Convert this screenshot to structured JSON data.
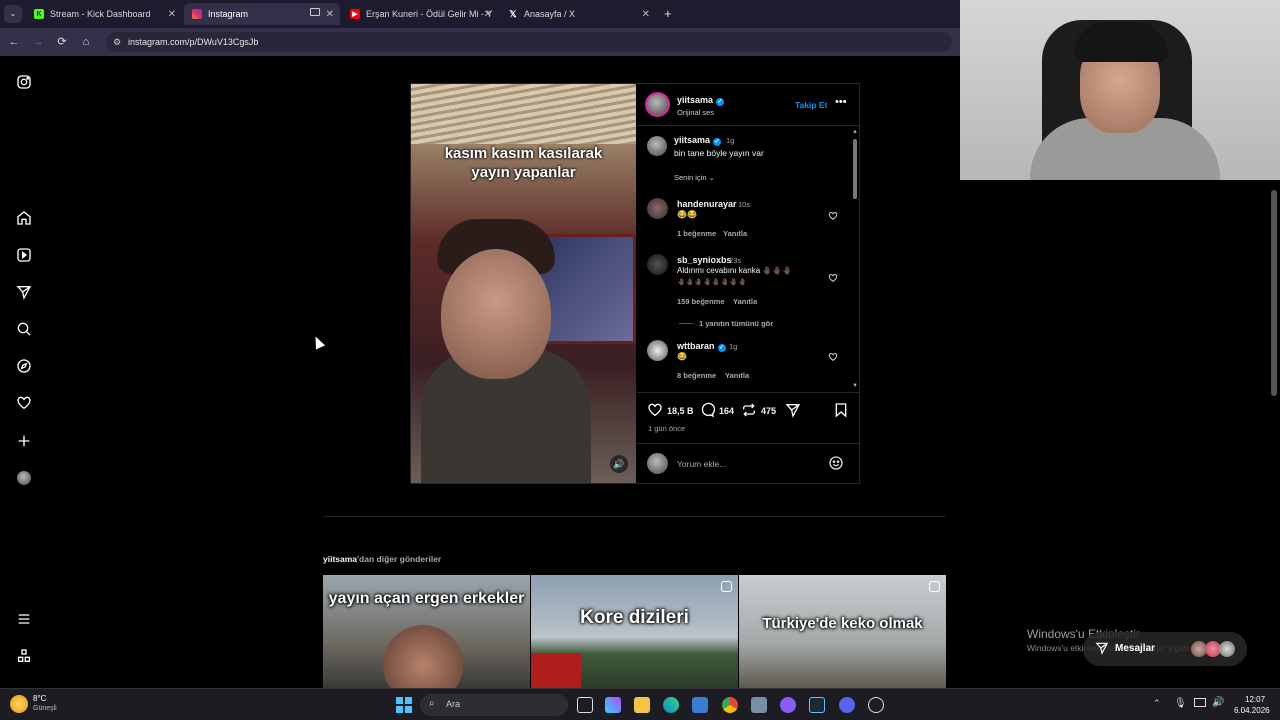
{
  "browser": {
    "tabs": [
      {
        "label": "Stream - Kick Dashboard",
        "active": false
      },
      {
        "label": "Instagram",
        "active": true
      },
      {
        "label": "Erşan Kuneri - Ödül Gelir Mi - Y",
        "active": false
      },
      {
        "label": "Anasayfa / X",
        "active": false
      }
    ],
    "new_tab": "+",
    "url": "instagram.com/p/DWuV13CgsJb"
  },
  "sidebar": {
    "icons": [
      "instagram-logo-icon",
      "home-icon",
      "reels-icon",
      "send-icon",
      "search-icon",
      "explore-icon",
      "heart-icon",
      "create-icon",
      "profile-avatar",
      "menu-icon",
      "more-apps-icon"
    ]
  },
  "post": {
    "video_caption": "kasım kasım kasılarak yayın yapanlar",
    "author": "yiitsama",
    "audio": "Orijinal ses",
    "follow_label": "Takip Et",
    "caption_author": "yiitsama",
    "caption_time": "1g",
    "caption_text": "bin tane böyle yayın var",
    "sort_label": "Senin için",
    "comments": [
      {
        "user": "handenurayar",
        "time": "10s",
        "text": "😂😂",
        "likes": "1 beğenme",
        "reply": "Yanıtla"
      },
      {
        "user": "sb_synioxbs",
        "time": "23s",
        "text": "Aldınmı cevabını kanka 🤚🏿🤚🏿🤚🏿",
        "text2": "🤚🏿🤚🏿🤚🏿🤚🏿🤚🏿🤚🏿🤚🏿🤚🏿",
        "likes": "159 beğenme",
        "reply": "Yanıtla",
        "view_replies": "1 yanıtın tümünü gör"
      },
      {
        "user": "wttbaran",
        "time": "1g",
        "text": "😂",
        "likes": "8 beğenme",
        "reply": "Yanıtla"
      }
    ],
    "like_count": "18,5 B",
    "comment_count": "164",
    "repost_count": "475",
    "posted": "1 gün önce",
    "comment_placeholder": "Yorum ekle..."
  },
  "more_posts": {
    "owner": "yiitsama",
    "suffix": "'dan diğer gönderiler",
    "items": [
      {
        "title": "yayın açan ergen erkekler"
      },
      {
        "title": "Kore dizileri"
      },
      {
        "title": "Türkiye'de keko olmak"
      }
    ]
  },
  "overlay": {
    "activate_title": "Windows'u Etkinleştir",
    "activate_sub": "Windows'u etkinleştirmek için Ayarlar'a gidin.",
    "messages_label": "Mesajlar"
  },
  "taskbar": {
    "weather_temp": "8°C",
    "weather_desc": "Güneşli",
    "search_label": "Ara",
    "time": "12:07",
    "date": "6.04.2026"
  },
  "colors": {
    "accent": "#0095f6",
    "tabbar": "#1f1b2e",
    "addressbar": "#35304a"
  }
}
